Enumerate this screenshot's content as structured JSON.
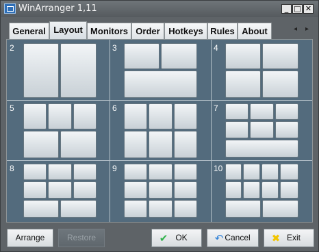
{
  "window": {
    "title": "WinArranger 1,11",
    "title_icon": "app-window-icon"
  },
  "titlebar_buttons": {
    "minimize": "_",
    "maximize": "□",
    "close": "✕"
  },
  "tabs": [
    "General",
    "Layout",
    "Monitors",
    "Order",
    "Hotkeys",
    "Rules",
    "About"
  ],
  "active_tab": "Layout",
  "tab_scroll": {
    "left": "◂",
    "right": "▸"
  },
  "layouts": [
    "2",
    "3",
    "4",
    "5",
    "6",
    "7",
    "8",
    "9",
    "10"
  ],
  "buttons": {
    "arrange": "Arrange",
    "restore": "Restore",
    "ok": "OK",
    "cancel": "Cancel",
    "exit": "Exit"
  },
  "icons": {
    "ok": "check-icon",
    "cancel": "cancel-icon",
    "exit": "exit-icon"
  },
  "colors": {
    "panel": "#536b7d",
    "accent_ok": "#2fb24a",
    "accent_exit": "#f2c500"
  }
}
